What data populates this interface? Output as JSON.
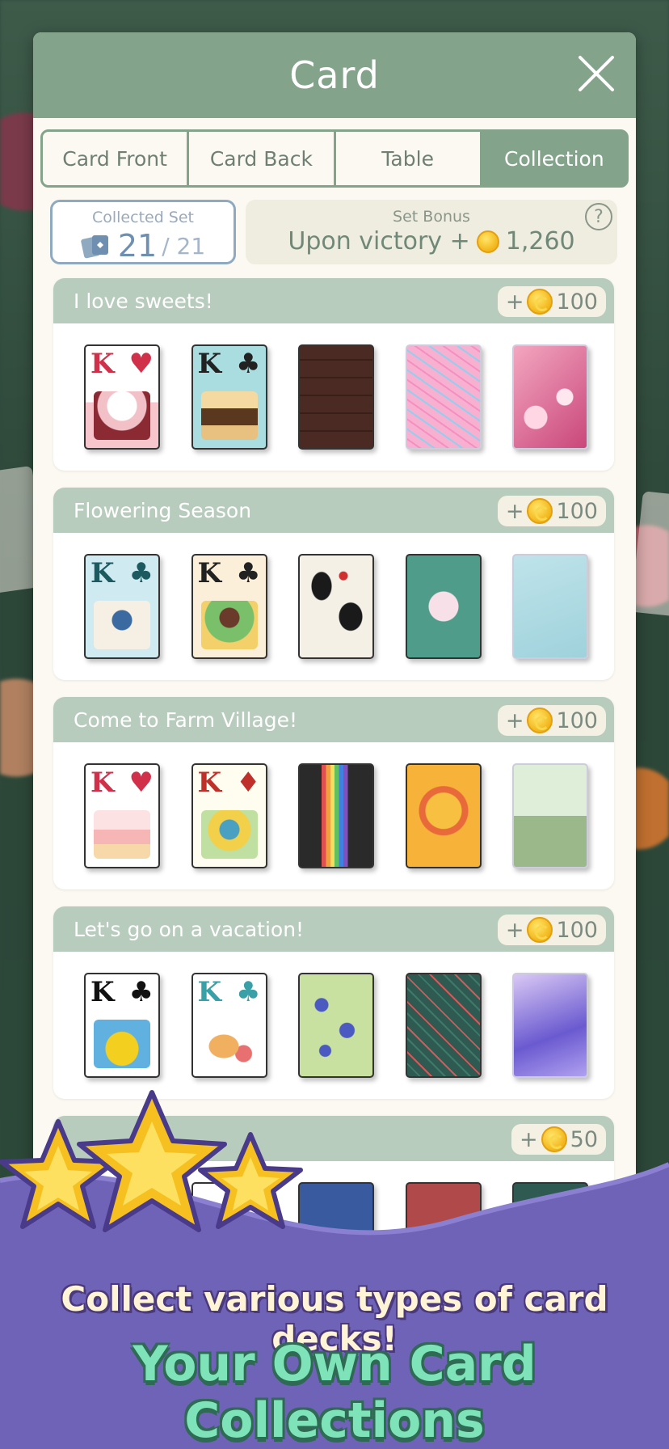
{
  "window": {
    "title": "Card",
    "close_icon": "close-icon"
  },
  "tabs": [
    {
      "label": "Card Front",
      "active": false
    },
    {
      "label": "Card Back",
      "active": false
    },
    {
      "label": "Table",
      "active": false
    },
    {
      "label": "Collection",
      "active": true
    }
  ],
  "summary": {
    "collected_label": "Collected Set",
    "collected_count": "21",
    "collected_total": "/ 21",
    "bonus_label": "Set Bonus",
    "bonus_text": "Upon victory +",
    "bonus_amount": "1,260",
    "help_label": "?"
  },
  "sets": [
    {
      "name": "I love sweets!",
      "reward_prefix": "+",
      "reward": "100"
    },
    {
      "name": "Flowering Season",
      "reward_prefix": "+",
      "reward": "100"
    },
    {
      "name": "Come to Farm Village!",
      "reward_prefix": "+",
      "reward": "100"
    },
    {
      "name": "Let's go on a vacation!",
      "reward_prefix": "+",
      "reward": "100"
    },
    {
      "name": "",
      "reward_prefix": "+",
      "reward": "50"
    }
  ],
  "card_text": {
    "rank": "K",
    "heart": "♥",
    "club": "♣",
    "diamond": "♦"
  },
  "banner": {
    "tagline": "Collect various types of card decks!",
    "headline": "Your Own Card Collections"
  },
  "colors": {
    "header": "#84a38b",
    "set_header": "#b8ccbd",
    "panel": "#fbf9f1",
    "banner": "#6f63b8",
    "coin": "#f2b51a"
  }
}
